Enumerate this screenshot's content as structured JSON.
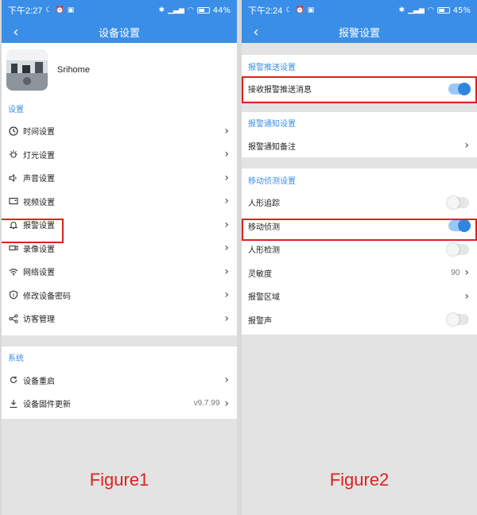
{
  "figure1": {
    "status": {
      "time": "下午2:27",
      "battery": "44%"
    },
    "nav_title": "设备设置",
    "device_name": "Srihome",
    "group_settings": "设置",
    "items": [
      {
        "label": "时间设置",
        "icon": "clock-icon"
      },
      {
        "label": "灯光设置",
        "icon": "light-icon"
      },
      {
        "label": "声音设置",
        "icon": "speaker-icon"
      },
      {
        "label": "视频设置",
        "icon": "video-screen-icon"
      },
      {
        "label": "报警设置",
        "icon": "bell-icon"
      },
      {
        "label": "录像设置",
        "icon": "camera-icon"
      },
      {
        "label": "网络设置",
        "icon": "wifi-icon"
      },
      {
        "label": "修改设备密码",
        "icon": "shield-icon"
      },
      {
        "label": "访客管理",
        "icon": "share-icon"
      }
    ],
    "group_system": "系统",
    "system_items": [
      {
        "label": "设备重启",
        "icon": "restart-icon",
        "value": ""
      },
      {
        "label": "设备固件更新",
        "icon": "download-icon",
        "value": "v9.7.99"
      }
    ],
    "caption": "Figure1"
  },
  "figure2": {
    "status": {
      "time": "下午2:24",
      "battery": "45%"
    },
    "nav_title": "报警设置",
    "push_group": "报警推送设置",
    "push_item": "接收报警推送消息",
    "push_on": true,
    "notify_group": "报警通知设置",
    "notify_item": "报警通知备注",
    "motion_group": "移动侦测设置",
    "motion_items": [
      {
        "label": "人形追踪",
        "type": "toggle",
        "on": false
      },
      {
        "label": "移动侦测",
        "type": "toggle",
        "on": true
      },
      {
        "label": "人形检测",
        "type": "toggle",
        "on": false
      },
      {
        "label": "灵敏度",
        "type": "value",
        "value": "90"
      },
      {
        "label": "报警区域",
        "type": "link"
      },
      {
        "label": "报警声",
        "type": "toggle",
        "on": false
      }
    ],
    "caption": "Figure2"
  },
  "colors": {
    "accent": "#3a8ee8",
    "highlight": "#e02020",
    "toggle_on": "#2f86e0"
  }
}
